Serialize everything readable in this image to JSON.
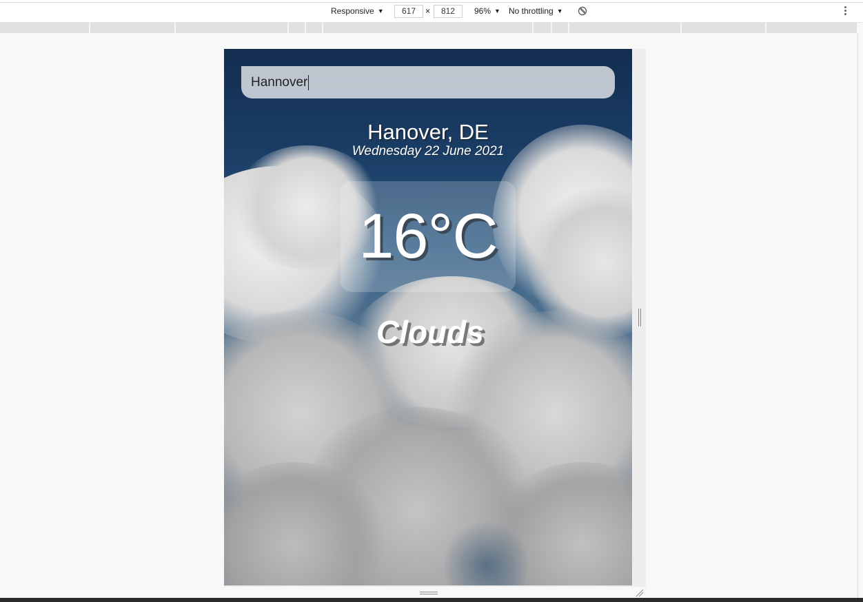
{
  "devtools": {
    "device_mode": "Responsive",
    "width": "617",
    "times": "×",
    "height": "812",
    "zoom": "96%",
    "throttling": "No throttling",
    "caret": "▼",
    "icons": [
      "rotate-icon",
      "kebab-menu-icon",
      "resize-handle-icon"
    ]
  },
  "app": {
    "search_value": "Hannover",
    "location": "Hanover, DE",
    "date": "Wednesday 22 June 2021",
    "temperature": "16°C",
    "weather": "Clouds"
  },
  "colors": {
    "sky_top": "#132d4f",
    "sky_mid": "#335f86",
    "cloud": "#c7c7c7"
  }
}
